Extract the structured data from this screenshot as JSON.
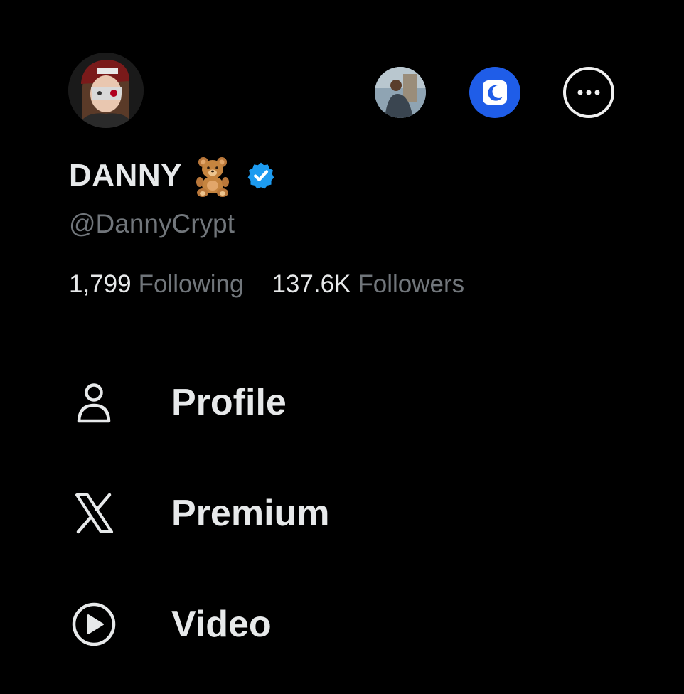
{
  "profile": {
    "display_name": "DANNY",
    "name_emoji": "teddy-bear-emoji",
    "verified": true,
    "handle": "@DannyCrypt"
  },
  "stats": {
    "following_count": "1,799",
    "following_label": "Following",
    "followers_count": "137.6K",
    "followers_label": "Followers"
  },
  "top_actions": {
    "alt_account_icon": "account-avatar",
    "night_mode_icon": "moon-icon",
    "more_icon": "more-dots-icon"
  },
  "menu": {
    "items": [
      {
        "label": "Profile",
        "icon": "person-icon"
      },
      {
        "label": "Premium",
        "icon": "x-logo-icon"
      },
      {
        "label": "Video",
        "icon": "play-circle-icon"
      }
    ]
  },
  "colors": {
    "background": "#000000",
    "primary_text": "#e7e9ea",
    "secondary_text": "#71767b",
    "verified_blue": "#1d9bf0",
    "night_toggle": "#1f5de8"
  }
}
